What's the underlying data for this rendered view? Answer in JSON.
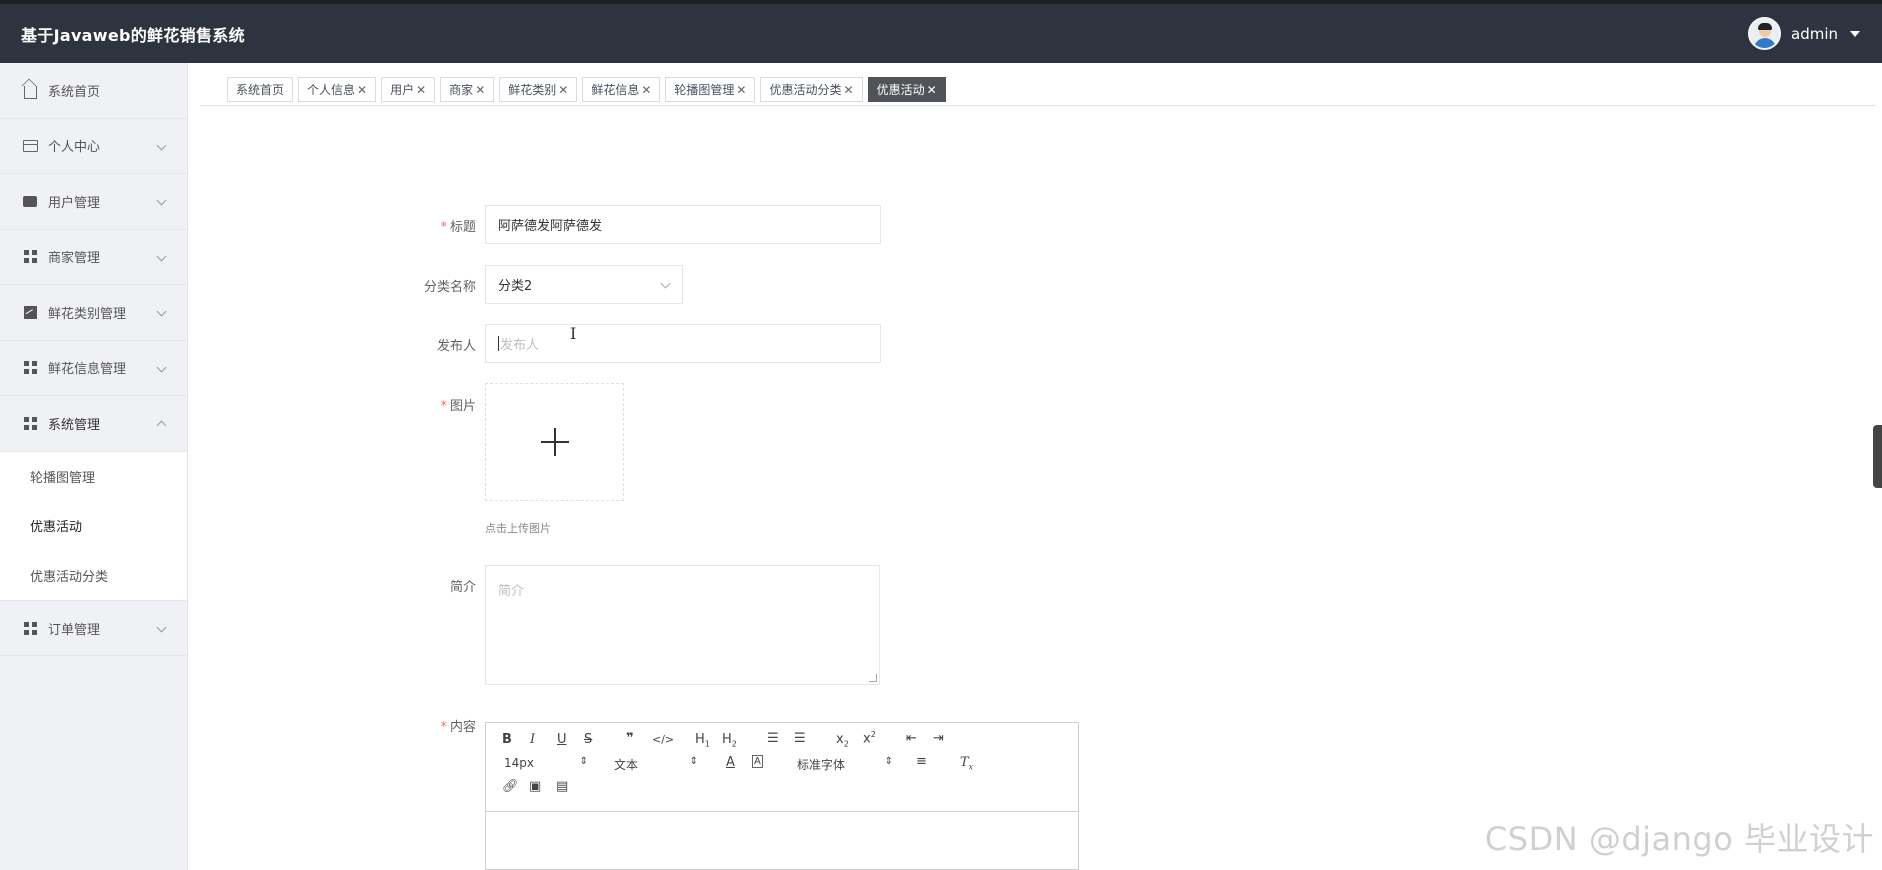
{
  "header": {
    "title": "基于Javaweb的鲜花销售系统",
    "user": "admin",
    "bg_color": "#2d3440"
  },
  "sidebar": {
    "items": [
      {
        "label": "系统首页",
        "icon": "home-icon"
      },
      {
        "label": "个人中心",
        "icon": "card-icon"
      },
      {
        "label": "用户管理",
        "icon": "chat-icon"
      },
      {
        "label": "商家管理",
        "icon": "grid-icon"
      },
      {
        "label": "鲜花类别管理",
        "icon": "chart-icon"
      },
      {
        "label": "鲜花信息管理",
        "icon": "grid-icon"
      },
      {
        "label": "系统管理",
        "icon": "grid-icon"
      },
      {
        "label": "订单管理",
        "icon": "grid-icon"
      }
    ],
    "submenu": [
      "轮播图管理",
      "优惠活动",
      "优惠活动分类"
    ]
  },
  "tabs": [
    {
      "label": "系统首页"
    },
    {
      "label": "个人信息"
    },
    {
      "label": "用户"
    },
    {
      "label": "商家"
    },
    {
      "label": "鲜花类别"
    },
    {
      "label": "鲜花信息"
    },
    {
      "label": "轮播图管理"
    },
    {
      "label": "优惠活动分类"
    },
    {
      "label": "优惠活动"
    }
  ],
  "form": {
    "title_label": "标题",
    "title_value": "阿萨德发阿萨德发",
    "category_label": "分类名称",
    "category_value": "分类2",
    "publisher_label": "发布人",
    "publisher_placeholder": "发布人",
    "image_label": "图片",
    "image_hint": "点击上传图片",
    "intro_label": "简介",
    "intro_placeholder": "简介",
    "content_label": "内容"
  },
  "editor": {
    "font_size": "14px",
    "text_style": "文本",
    "font_family": "标准字体"
  },
  "watermark": "CSDN @django 毕业设计"
}
